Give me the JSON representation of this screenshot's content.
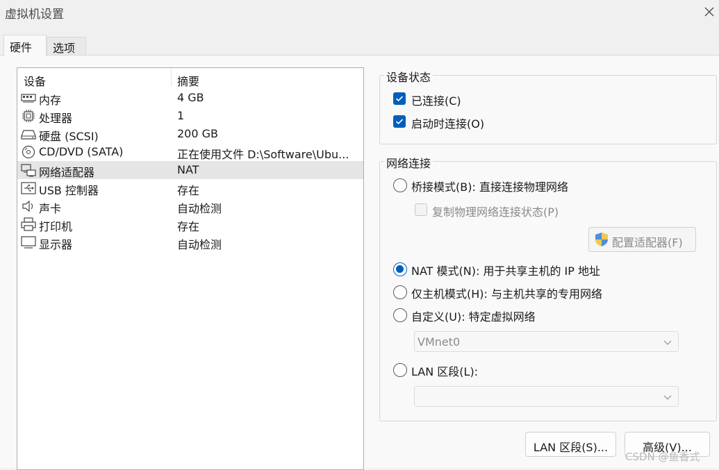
{
  "window": {
    "title": "虚拟机设置"
  },
  "tabs": [
    {
      "label": "硬件"
    },
    {
      "label": "选项"
    }
  ],
  "device_list": {
    "columns": {
      "device": "设备",
      "summary": "摘要"
    },
    "rows": [
      {
        "name": "内存",
        "summary": "4 GB",
        "icon": "memory-icon"
      },
      {
        "name": "处理器",
        "summary": "1",
        "icon": "processor-icon"
      },
      {
        "name": "硬盘 (SCSI)",
        "summary": "200 GB",
        "icon": "hard-disk-icon"
      },
      {
        "name": "CD/DVD (SATA)",
        "summary": "正在使用文件 D:\\Software\\Ubu...",
        "icon": "cd-dvd-icon"
      },
      {
        "name": "网络适配器",
        "summary": "NAT",
        "icon": "network-adapter-icon",
        "selected": true
      },
      {
        "name": "USB 控制器",
        "summary": "存在",
        "icon": "usb-icon"
      },
      {
        "name": "声卡",
        "summary": "自动检测",
        "icon": "speaker-icon"
      },
      {
        "name": "打印机",
        "summary": "存在",
        "icon": "printer-icon"
      },
      {
        "name": "显示器",
        "summary": "自动检测",
        "icon": "monitor-icon"
      }
    ]
  },
  "device_status": {
    "title": "设备状态",
    "connected": {
      "label": "已连接(C)",
      "checked": true
    },
    "connect_on_power": {
      "label": "启动时连接(O)",
      "checked": true
    }
  },
  "network": {
    "title": "网络连接",
    "bridged": {
      "label": "桥接模式(B): 直接连接物理网络",
      "selected": false
    },
    "replicate": {
      "label": "复制物理网络连接状态(P)",
      "checked": false
    },
    "configure_button": "配置适配器(F)",
    "nat": {
      "label": "NAT 模式(N): 用于共享主机的 IP 地址",
      "selected": true
    },
    "host_only": {
      "label": "仅主机模式(H): 与主机共享的专用网络",
      "selected": false
    },
    "custom": {
      "label": "自定义(U): 特定虚拟网络",
      "selected": false
    },
    "custom_select": "VMnet0",
    "lan_segment": {
      "label": "LAN 区段(L):",
      "selected": false
    },
    "lan_select": ""
  },
  "buttons": {
    "lan_segments": "LAN 区段(S)...",
    "advanced": "高级(V)..."
  },
  "watermark": "CSDN @鱼香式",
  "colors": {
    "accent": "#005fb8",
    "selected_row": "#e5e5e5"
  }
}
